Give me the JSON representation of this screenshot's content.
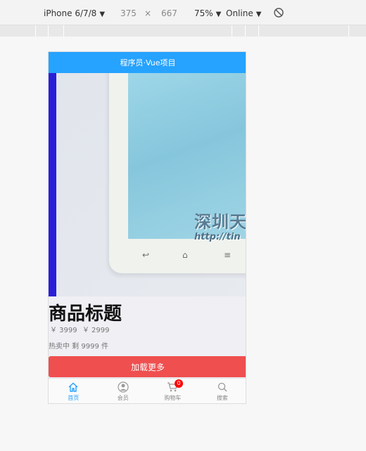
{
  "devtools": {
    "device": "iPhone 6/7/8",
    "width": "375",
    "times": "×",
    "height": "667",
    "zoom": "75%",
    "network": "Online"
  },
  "app": {
    "header_title": "程序员·Vue项目",
    "swipe": {
      "watermark_text": "深圳天",
      "watermark_url": "http://tin"
    },
    "product": {
      "title": "商品标题",
      "price_now": "￥ 3999",
      "price_old": "￥ 2999",
      "stock_text": "热卖中 剩 9999 件"
    },
    "load_more_label": "加载更多",
    "tabbar": {
      "items": [
        {
          "label": "首页",
          "icon": "home-icon",
          "active": true
        },
        {
          "label": "会员",
          "icon": "user-icon"
        },
        {
          "label": "购物车",
          "icon": "cart-icon",
          "badge": "0"
        },
        {
          "label": "搜索",
          "icon": "search-icon"
        }
      ]
    }
  },
  "colors": {
    "header": "#26a2ff",
    "button": "#ef4f4f",
    "badge": "#ff0000",
    "swipe_indicator": "#2a1fd8"
  }
}
